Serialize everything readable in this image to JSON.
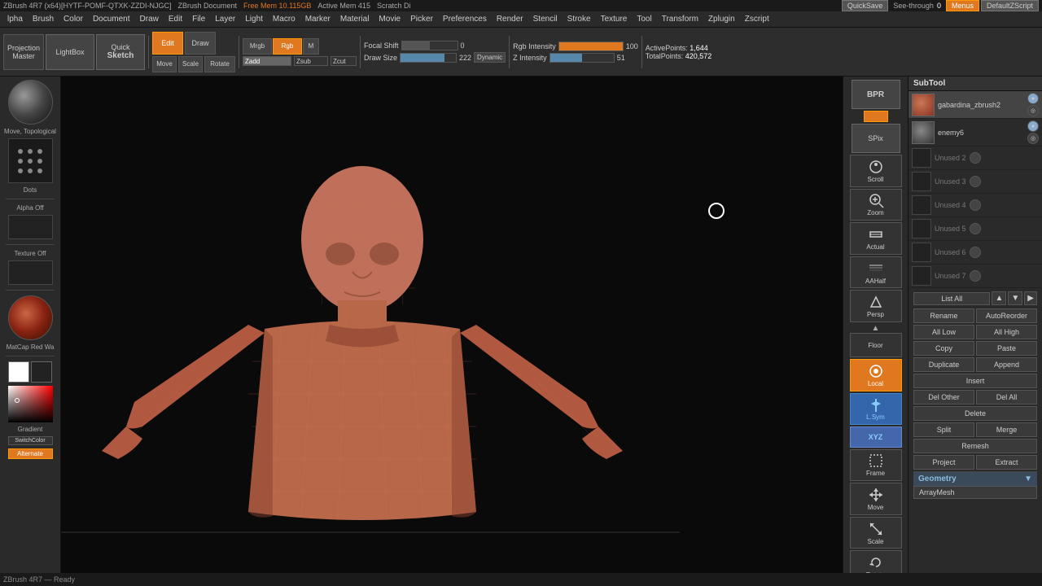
{
  "app": {
    "title": "ZBrush 4R7 (x64)[HYTF-POMF-QTXK-ZZDI-NJGC]",
    "doc_label": "ZBrush Document",
    "free_mem": "Free Mem 10.115GB",
    "active_mem": "Active Mem 415",
    "scratch": "Scratch Di",
    "quicksave_label": "QuickSave",
    "see_through_label": "See-through",
    "see_through_val": "0",
    "menus_label": "Menus",
    "default_zscript": "DefaultZScript"
  },
  "menu_items": [
    "lpha",
    "Brush",
    "Color",
    "Document",
    "Draw",
    "Edit",
    "File",
    "Layer",
    "Light",
    "Macro",
    "Marker",
    "Material",
    "Movie",
    "Picker",
    "Preferences",
    "Render",
    "Stencil",
    "Stroke",
    "Texture",
    "Tool",
    "Transform",
    "Zplugin",
    "Zscript"
  ],
  "toolbar": {
    "projection_label": "Projection",
    "master_label": "Master",
    "lightbox_label": "LightBox",
    "quick_sketch_label": "Quick Sketch",
    "edit_label": "Edit",
    "draw_label": "Draw",
    "move_label": "Move",
    "scale_label": "Scale",
    "rotate_label": "Rotate",
    "mrgb_label": "Mrgb",
    "rgb_label": "Rgb",
    "m_label": "M",
    "zadd_label": "Zadd",
    "zsub_label": "Zsub",
    "zcut_label": "Zcut",
    "focal_shift_label": "Focal Shift",
    "focal_shift_val": "0",
    "draw_size_label": "Draw Size",
    "draw_size_val": "222",
    "dynamic_label": "Dynamic",
    "rgb_intensity_label": "Rgb Intensity",
    "rgb_intensity_val": "100",
    "z_intensity_label": "Z Intensity",
    "z_intensity_val": "51",
    "active_points_label": "ActivePoints:",
    "active_points_val": "1,644",
    "total_points_label": "TotalPoints:",
    "total_points_val": "420,572"
  },
  "left_panel": {
    "brush_label": "Move, Topological",
    "dots_label": "Dots",
    "alpha_label": "Alpha  Off",
    "texture_label": "Texture  Off",
    "matcap_label": "MatCap Red Wa",
    "gradient_label": "Gradient",
    "switch_color_label": "SwitchColor",
    "alternate_label": "Alternate"
  },
  "right_tools": {
    "bpr_label": "BPR",
    "spix_label": "SPix",
    "scroll_label": "Scroll",
    "zoom_label": "Zoom",
    "actual_label": "Actual",
    "aahalf_label": "AAHalf",
    "persp_label": "Persp",
    "floor_label": "Floor",
    "local_label": "Local",
    "lsym_label": "L.Sym",
    "xyz_label": "XYZ",
    "frame_label": "Frame",
    "move_label": "Move",
    "scale_label": "Scale",
    "rotate_label": "Rotate"
  },
  "subtool": {
    "header": "SubTool",
    "items": [
      {
        "name": "gabardina_zbrush2",
        "active": true
      },
      {
        "name": "enemy6",
        "active": false
      },
      {
        "name": "Unused 2",
        "active": false
      },
      {
        "name": "Unused 3",
        "active": false
      },
      {
        "name": "Unused 4",
        "active": false
      },
      {
        "name": "Unused 5",
        "active": false
      },
      {
        "name": "Unused 6",
        "active": false
      },
      {
        "name": "Unused 7",
        "active": false
      }
    ],
    "list_all_label": "List All",
    "rename_label": "Rename",
    "auto_reorder_label": "AutoReorder",
    "all_low_label": "All Low",
    "all_high_label": "All High",
    "copy_label": "Copy",
    "paste_label": "Paste",
    "duplicate_label": "Duplicate",
    "append_label": "Append",
    "insert_label": "Insert",
    "del_other_label": "Del Other",
    "delete_label": "Delete",
    "del_all_label": "Del All",
    "split_label": "Split",
    "merge_label": "Merge",
    "remesh_label": "Remesh",
    "project_label": "Project",
    "extract_label": "Extract",
    "geometry_label": "Geometry",
    "arraymesh_label": "ArrayMesh"
  }
}
